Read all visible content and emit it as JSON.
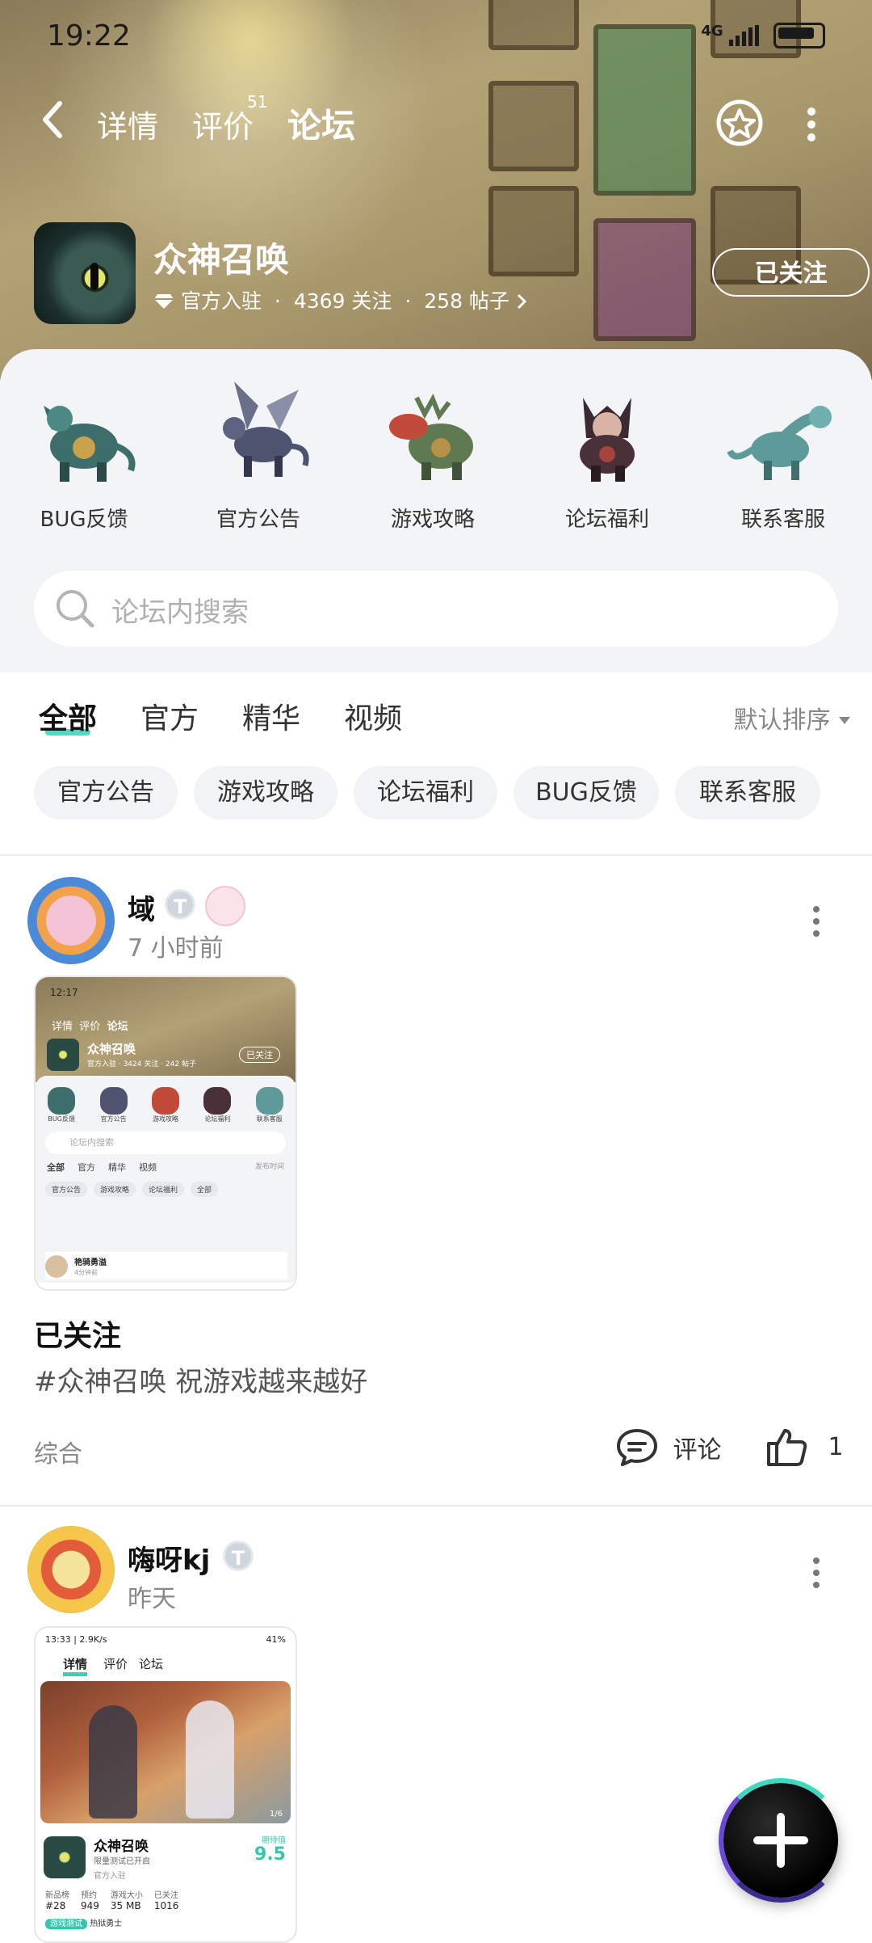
{
  "status": {
    "time": "19:22",
    "network": "4G"
  },
  "nav": {
    "back_icon": "chevron-left-icon",
    "tabs": [
      {
        "label": "详情"
      },
      {
        "label": "评价",
        "count": "51"
      },
      {
        "label": "论坛"
      }
    ],
    "favorite_icon": "star-icon",
    "more_icon": "more-vertical-icon"
  },
  "app": {
    "name": "众神召唤",
    "verified": "官方入驻",
    "followers": "4369 关注",
    "posts": "258 帖子",
    "follow_label": "已关注",
    "sep": "·"
  },
  "categories": [
    "BUG反馈",
    "官方公告",
    "游戏攻略",
    "论坛福利",
    "联系客服"
  ],
  "search": {
    "placeholder": "论坛内搜索"
  },
  "filter_tabs": [
    "全部",
    "官方",
    "精华",
    "视频"
  ],
  "sort_label": "默认排序",
  "chips": [
    "官方公告",
    "游戏攻略",
    "论坛福利",
    "BUG反馈",
    "联系客服"
  ],
  "posts": [
    {
      "user": "域",
      "badge": "T",
      "time": "7 小时前",
      "title": "已关注",
      "text": "#众神召唤 祝游戏越来越好",
      "category": "综合",
      "comment_label": "评论",
      "likes": "1",
      "thumb": {
        "time": "12:17",
        "tabs": [
          "详情",
          "评价",
          "论坛"
        ],
        "app": "众神召唤",
        "meta": "官方入驻 · 3424 关注 · 242 帖子",
        "follow": "已关注",
        "cats": [
          "BUG反馈",
          "官方公告",
          "游戏攻略",
          "论坛福利",
          "联系客服"
        ],
        "search": "论坛内搜索",
        "ftabs": [
          "全部",
          "官方",
          "精华",
          "视频"
        ],
        "sort": "发布时间",
        "chips": [
          "官方公告",
          "游戏攻略",
          "论坛福利",
          "全部"
        ],
        "user": "艳骑勇溢",
        "utime": "4分钟前"
      }
    },
    {
      "user": "嗨呀kj",
      "badge": "T",
      "time": "昨天",
      "thumb": {
        "status": "13:33 | 2.9K/s",
        "battery": "41%",
        "tabs": [
          "详情",
          "评价",
          "论坛"
        ],
        "page": "1/6",
        "app": "众神召唤",
        "sub": "限量测试已开启",
        "verified": "官方入驻",
        "score_label": "期待值",
        "score": "9.5",
        "stats": [
          {
            "k": "新品榜",
            "v": "#28"
          },
          {
            "k": "预约",
            "v": "949"
          },
          {
            "k": "游戏大小",
            "v": "35 MB"
          },
          {
            "k": "已关注",
            "v": "1016"
          }
        ],
        "tag": "游戏测试",
        "tag2": "热狱勇士"
      }
    }
  ],
  "fab_icon": "plus-icon"
}
